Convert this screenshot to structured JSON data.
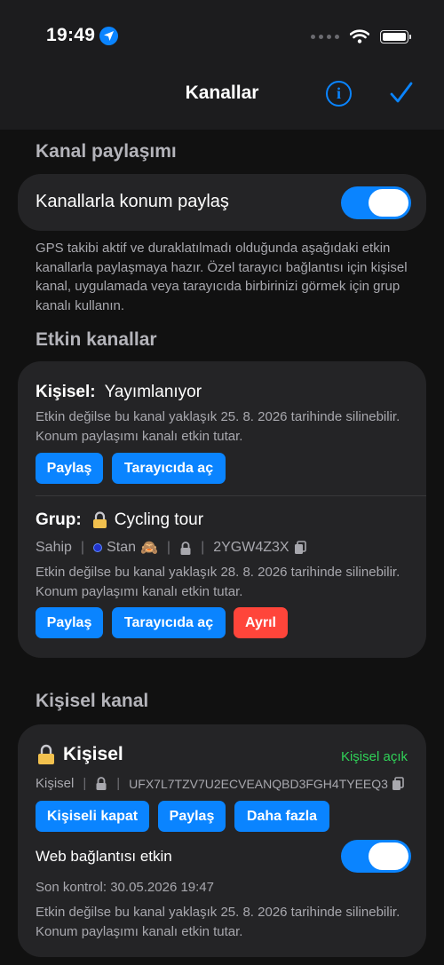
{
  "status": {
    "time": "19:49"
  },
  "nav": {
    "title": "Kanallar"
  },
  "sharing": {
    "section_title": "Kanal paylaşımı",
    "toggle_label": "Kanallarla konum paylaş",
    "toggle_on": true,
    "description": "GPS takibi aktif ve duraklatılmadı olduğunda aşağıdaki etkin kanallarla paylaşmaya hazır. Özel tarayıcı bağlantısı için kişisel kanal, uygulamada veya tarayıcıda birbirinizi görmek için grup kanalı kullanın."
  },
  "active": {
    "section_title": "Etkin kanallar",
    "personal": {
      "label": "Kişisel:",
      "status": "Yayımlanıyor",
      "expiry": "Etkin değilse bu kanal yaklaşık 25. 8. 2026 tarihinde silinebilir. Konum paylaşımı kanalı etkin tutar.",
      "share_button": "Paylaş",
      "open_browser_button": "Tarayıcıda aç"
    },
    "group": {
      "label": "Grup:",
      "name": "Cycling tour",
      "role": "Sahip",
      "member": "Stan",
      "member_emoji": "🙈",
      "code": "2YGW4Z3X",
      "expiry": "Etkin değilse bu kanal yaklaşık 28. 8. 2026 tarihinde silinebilir. Konum paylaşımı kanalı etkin tutar.",
      "share_button": "Paylaş",
      "open_browser_button": "Tarayıcıda aç",
      "leave_button": "Ayrıl"
    }
  },
  "personal_channel": {
    "section_title": "Kişisel kanal",
    "title": "Kişisel",
    "state": "Kişisel açık",
    "type": "Kişisel",
    "code": "UFX7L7TZV7U2ECVEANQBD3FGH4TYEEQ3",
    "close_button": "Kişiseli kapat",
    "share_button": "Paylaş",
    "more_button": "Daha fazla",
    "web_link_label": "Web bağlantısı etkin",
    "web_link_on": true,
    "last_check": "Son kontrol: 30.05.2026 19:47",
    "expiry": "Etkin değilse bu kanal yaklaşık 25. 8. 2026 tarihinde silinebilir. Konum paylaşımı kanalı etkin tutar."
  },
  "icons": {
    "location": "location-arrow-icon",
    "signal": "cellular-dots-icon",
    "wifi": "wifi-icon",
    "battery": "battery-icon",
    "info": "info-icon",
    "done": "checkmark-icon",
    "lock": "lock-icon",
    "copy": "copy-icon"
  },
  "colors": {
    "accent": "#0a84ff",
    "danger": "#ff453a",
    "success": "#30d158",
    "background": "#111111",
    "card": "#242426"
  }
}
